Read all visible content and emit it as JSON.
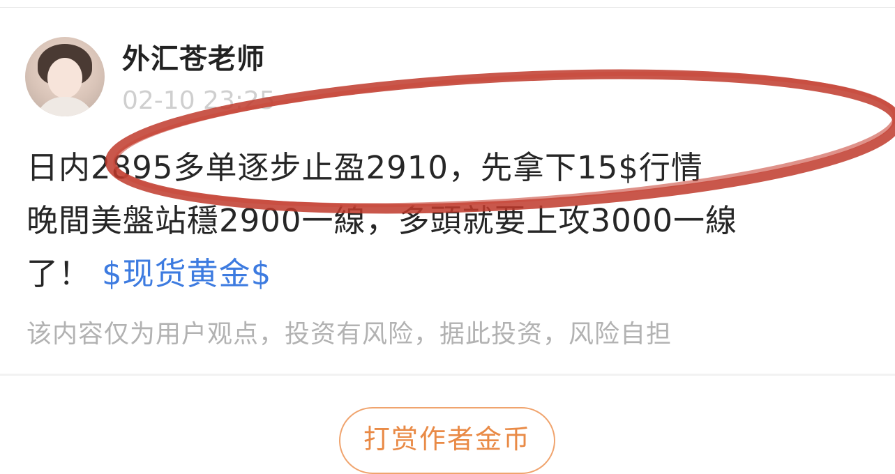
{
  "post": {
    "author": "外汇苍老师",
    "time": "02-10 23:25",
    "lines": [
      "日内2895多单逐步止盈2910，先拿下15$行情",
      "晚間美盤站穩2900一線，多頭就要上攻3000一線",
      "了！"
    ],
    "tag": "$现货黄金$",
    "disclaimer": "该内容仅为用户观点，投资有风险，据此投资，风险自担"
  },
  "actions": {
    "tip_label": "打赏作者金币"
  },
  "colors": {
    "link": "#3d7be0",
    "tip": "#e98a46",
    "annotation": "#c0392b"
  }
}
